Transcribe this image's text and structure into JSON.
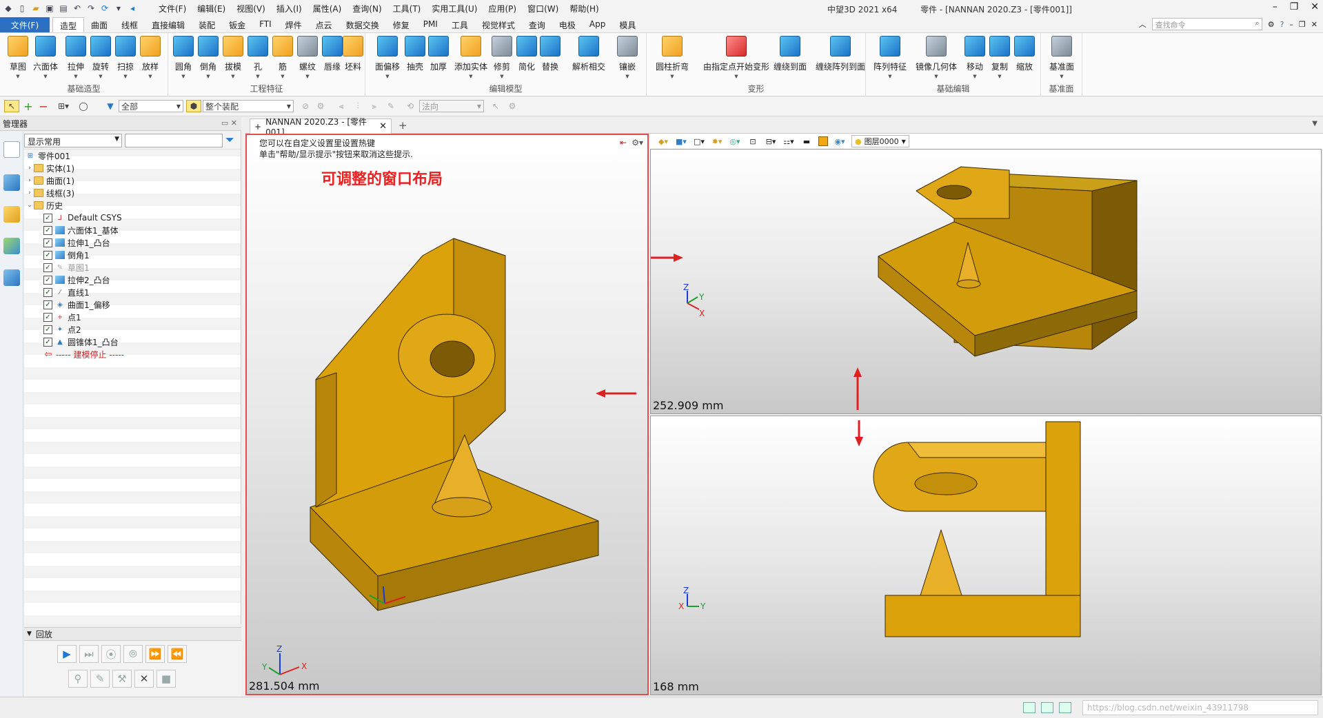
{
  "app": {
    "window_title": "中望3D 2021 x64",
    "doc_title": "零件 - [NANNAN 2020.Z3 - [零件001]]",
    "menu": [
      "文件(F)",
      "编辑(E)",
      "视图(V)",
      "插入(I)",
      "属性(A)",
      "查询(N)",
      "工具(T)",
      "实用工具(U)",
      "应用(P)",
      "窗口(W)",
      "帮助(H)"
    ]
  },
  "ribbon": {
    "file_label": "文件(F)",
    "tabs": [
      "造型",
      "曲面",
      "线框",
      "直接编辑",
      "装配",
      "钣金",
      "FTI",
      "焊件",
      "点云",
      "数据交换",
      "修复",
      "PMI",
      "工具",
      "视觉样式",
      "查询",
      "电极",
      "App",
      "模具"
    ],
    "active_tab": "造型",
    "search_placeholder": "查找命令",
    "groups": [
      {
        "label": "基础造型",
        "buttons": [
          "草图",
          "六面体",
          "拉伸",
          "旋转",
          "扫掠",
          "放样"
        ]
      },
      {
        "label": "工程特征",
        "buttons": [
          "圆角",
          "倒角",
          "拔模",
          "孔",
          "筋",
          "螺纹",
          "唇缘",
          "坯料"
        ]
      },
      {
        "label": "编辑模型",
        "buttons": [
          "面偏移",
          "抽壳",
          "加厚",
          "添加实体",
          "修剪",
          "简化",
          "替换",
          "解析相交",
          "镶嵌"
        ]
      },
      {
        "label": "变形",
        "buttons": [
          "圆柱折弯",
          "由指定点开始变形",
          "缠绕到面",
          "缠绕阵列到面"
        ]
      },
      {
        "label": "基础编辑",
        "buttons": [
          "阵列特征",
          "镜像几何体",
          "移动",
          "复制",
          "缩放"
        ]
      },
      {
        "label": "基准面",
        "buttons": [
          "基准面"
        ]
      }
    ]
  },
  "filterbar": {
    "filter_value": "全部",
    "assembly_value": "整个装配",
    "direction_value": "法向"
  },
  "manager": {
    "title": "管理器",
    "display_combo": "显示常用",
    "tree": [
      {
        "label": "零件001",
        "level": 0,
        "icon": "part"
      },
      {
        "label": "实体(1)",
        "level": 1,
        "icon": "folder"
      },
      {
        "label": "曲面(1)",
        "level": 1,
        "icon": "folder"
      },
      {
        "label": "线框(3)",
        "level": 1,
        "icon": "folder"
      },
      {
        "label": "历史",
        "level": 1,
        "icon": "folder"
      },
      {
        "label": "Default CSYS",
        "level": 2,
        "icon": "csys"
      },
      {
        "label": "六面体1_基体",
        "level": 2,
        "icon": "cube"
      },
      {
        "label": "拉伸1_凸台",
        "level": 2,
        "icon": "cube"
      },
      {
        "label": "倒角1",
        "level": 2,
        "icon": "cube"
      },
      {
        "label": "草图1",
        "level": 2,
        "icon": "sketch"
      },
      {
        "label": "拉伸2_凸台",
        "level": 2,
        "icon": "cube"
      },
      {
        "label": "直线1",
        "level": 2,
        "icon": "line"
      },
      {
        "label": "曲面1_偏移",
        "level": 2,
        "icon": "surface"
      },
      {
        "label": "点1",
        "level": 2,
        "icon": "point"
      },
      {
        "label": "点2",
        "level": 2,
        "icon": "point"
      },
      {
        "label": "圆锥体1_凸台",
        "level": 2,
        "icon": "cone"
      }
    ],
    "stop_label": "----- 建模停止 -----",
    "playback_title": "回放"
  },
  "document": {
    "tab_label": "NANNAN 2020.Z3 - [零件001]",
    "hint_line1": "您可以在自定义设置里设置热键",
    "hint_line2": "单击\"帮助/显示提示\"按钮来取消这些提示.",
    "layout_title": "可调整的窗口布局",
    "layer_label": "图层0000",
    "viewports": [
      {
        "scale": "281.504 mm"
      },
      {
        "scale": "252.909 mm"
      },
      {
        "scale": "168 mm"
      }
    ],
    "model_color": "#dca20b"
  },
  "statusbar": {
    "watermark": "https://blog.csdn.net/weixin_43911798"
  }
}
